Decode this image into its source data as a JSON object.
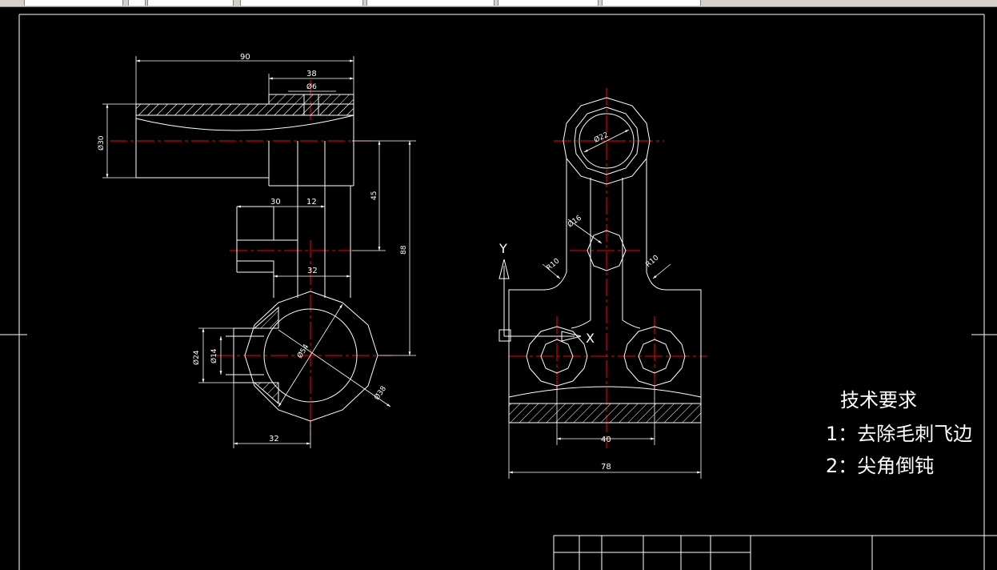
{
  "toolbar": {
    "slots": [
      "",
      "",
      "",
      "",
      "",
      "",
      "",
      ""
    ]
  },
  "colors": {
    "background": "#000000",
    "outline": "#ffffff",
    "centerline": "#ff0000"
  },
  "dimensions": {
    "front": {
      "d90": "90",
      "d38": "38",
      "d6": "Ø6",
      "d30": "Ø30",
      "d45": "45",
      "d88": "88",
      "d30b": "30",
      "d12": "12",
      "d32a": "32",
      "d24": "Ø24",
      "d14": "Ø14",
      "d54": "Ø54",
      "d38c": "Ø38",
      "d32b": "32"
    },
    "side": {
      "d22": "Ø22",
      "d16": "Ø16",
      "r10a": "R10",
      "r10b": "R10",
      "d40": "40",
      "d78": "78"
    }
  },
  "ucs": {
    "x_label": "X",
    "y_label": "Y"
  },
  "tech_requirements": {
    "title": "技术要求",
    "item1": "1：去除毛刺飞边",
    "item2": "2：尖角倒钝"
  }
}
